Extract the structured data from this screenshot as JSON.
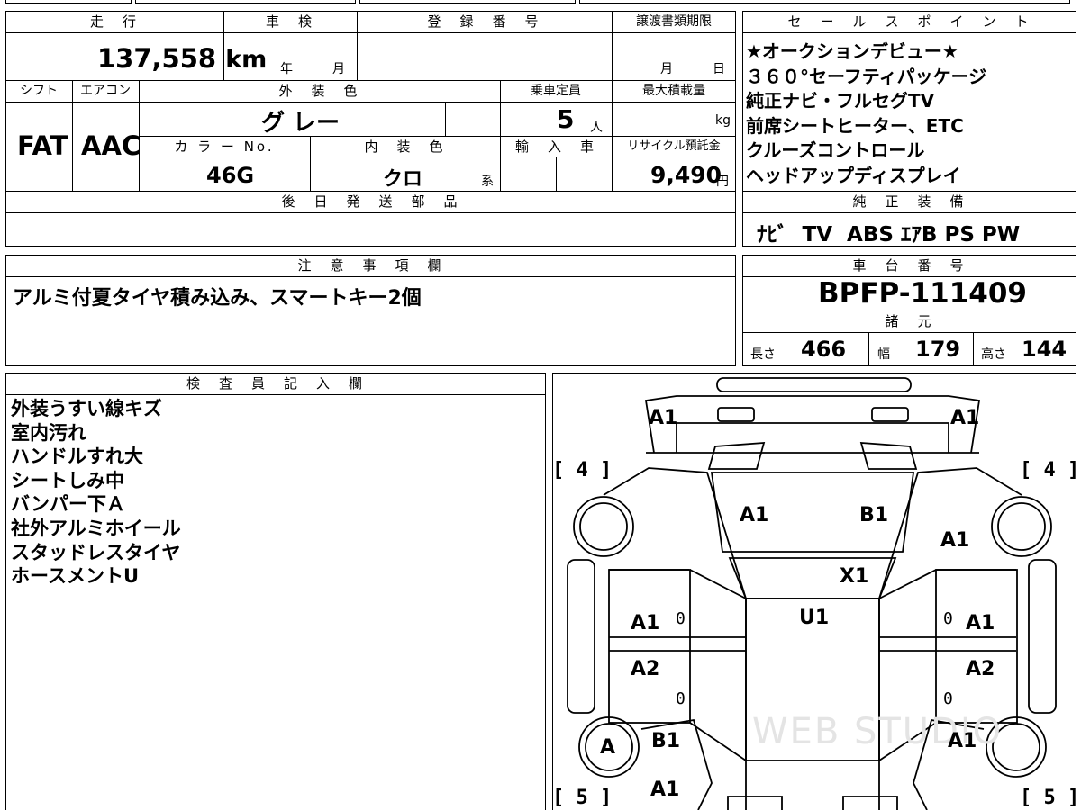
{
  "vehicle": {
    "mileage_header": "走　行",
    "mileage_value": "137,558",
    "mileage_unit": "km",
    "inspection_header": "車　検",
    "inspection_year": "年",
    "inspection_month": "月",
    "registration_header": "登　録　番　号",
    "transfer_header": "譲渡書類期限",
    "transfer_month": "月",
    "transfer_day": "日",
    "shift_header": "シフト",
    "shift_value": "FAT",
    "ac_header": "エアコン",
    "ac_value": "AAC",
    "exterior_header": "外　装　色",
    "exterior_value": "グ レー",
    "capacity_header": "乗車定員",
    "capacity_value": "5",
    "capacity_unit": "人",
    "maxload_header": "最大積載量",
    "maxload_unit": "kg",
    "color_no_header": "カ ラ ー No.",
    "color_no_value": "46G",
    "interior_header": "内　装　色",
    "interior_value": "クロ",
    "interior_suffix": "系",
    "import_header": "輸　入　車",
    "recycle_header": "リサイクル預託金",
    "recycle_value": "9,490",
    "recycle_unit": "円",
    "later_parts_header": "後　日　発　送　部　品"
  },
  "sales": {
    "header": "セ　ー　ル　ス　ポ　イ　ン　ト",
    "points": [
      "★オークションデビュー★",
      "３６０°セーフティパッケージ",
      "純正ナビ・フルセグTV",
      "前席シートヒーター、ETC",
      "クルーズコントロール",
      "ヘッドアップディスプレイ"
    ]
  },
  "equipment": {
    "header": "純　正　装　備",
    "items": "ﾅﾋﾞ  TV  ABS ｴｱB PS PW"
  },
  "notes": {
    "header": "注　意　事　項　欄",
    "text": "アルミ付夏タイヤ積み込み、スマートキー2個"
  },
  "chassis": {
    "header": "車　台　番　号",
    "number": "BPFP-111409"
  },
  "specs": {
    "header": "諸　元",
    "length_label": "長さ",
    "length_value": "466",
    "width_label": "幅",
    "width_value": "179",
    "height_label": "高さ",
    "height_value": "144"
  },
  "inspector": {
    "header": "検　査　員　記　入　欄",
    "lines": [
      "外装うすい線キズ",
      "室内汚れ",
      "ハンドルすれ大",
      "シートしみ中",
      "バンパー下Ａ",
      "社外アルミホイール",
      "スタッドレスタイヤ",
      "ホースメントU"
    ]
  },
  "diagram": {
    "front_left": "A1",
    "front_right": "A1",
    "hood_left": "A1",
    "hood_right": "B1",
    "fender_right": "A1",
    "windshield": "X1",
    "roof": "U1",
    "front_door_left": "A1",
    "front_door_right": "A1",
    "rear_door_left": "A2",
    "rear_door_right": "A2",
    "rear_wheel_left": "A",
    "rear_fender_left": "B1",
    "rear_fender_right": "A1",
    "rear_left": "A1",
    "tick": "0",
    "tire_front_left": "[ 4 ]",
    "tire_front_right": "[ 4 ]",
    "tire_rear_left": "[ 5 ]",
    "tire_rear_right": "[ 5 ]",
    "watermark": "WEB STUDIO"
  }
}
